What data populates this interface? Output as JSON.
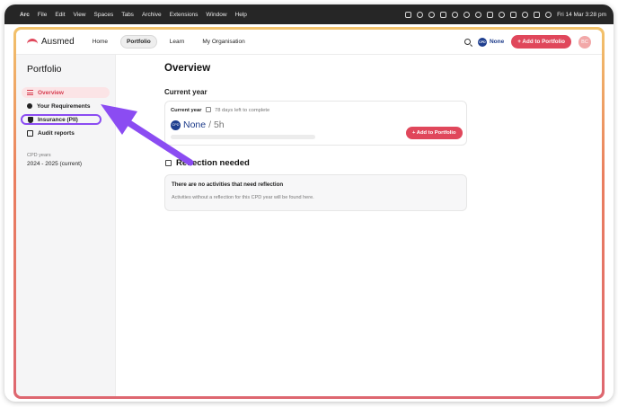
{
  "macos": {
    "menu": [
      "Arc",
      "File",
      "Edit",
      "View",
      "Spaces",
      "Tabs",
      "Archive",
      "Extensions",
      "Window",
      "Help"
    ],
    "clock": "Fri 14 Mar  3:28 pm"
  },
  "nav": {
    "brand": "Ausmed",
    "items": [
      "Home",
      "Portfolio",
      "Learn",
      "My Organisation"
    ],
    "active": "Portfolio",
    "cpd_badge": "CPD",
    "cpd_value": "None",
    "add_button": "+ Add to Portfolio",
    "avatar": "BC"
  },
  "sidebar": {
    "title": "Portfolio",
    "items": [
      "Overview",
      "Your Requirements",
      "Insurance (PII)",
      "Audit reports"
    ],
    "cpd_years_label": "CPD years",
    "cpd_years_value": "2024 - 2025 (current)"
  },
  "main": {
    "title": "Overview",
    "current_year_heading": "Current year",
    "card": {
      "label": "Current year",
      "days_left": "78 days left to complete",
      "cpd_badge": "CPD",
      "cpd_value": "None",
      "cpd_target": "/ 5h",
      "progress": 0,
      "add_button": "+ Add to Portfolio"
    },
    "reflection": {
      "heading": "Reflection needed",
      "title": "There are no activities that need reflection",
      "subtitle": "Activities without a reflection for this CPD year will be found here."
    }
  },
  "colors": {
    "accent": "#e0475b",
    "cpd_blue": "#1d3b8a",
    "annotation": "#8b4cf2"
  }
}
